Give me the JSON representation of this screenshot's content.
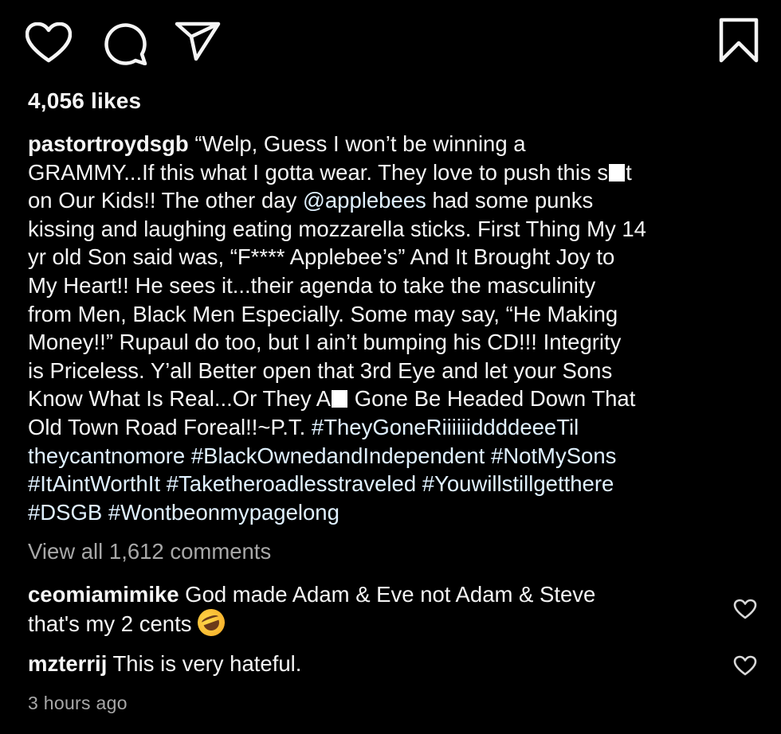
{
  "post": {
    "likes": "4,056 likes",
    "caption": {
      "username": "pastortroydsgb",
      "line1_text": " “Welp, Guess I won’t be winning a",
      "line2_a": "GRAMMY...If this what I gotta wear. They love to push this s",
      "line2_b": "t",
      "line3_a": "on Our Kids!! The other day ",
      "mention": "@applebees",
      "line3_b": " had some punks",
      "line4": "kissing and laughing eating mozzarella sticks. First Thing My 14",
      "line5": "yr old Son said was, “F**** Applebee’s” And It Brought Joy to",
      "line6": "My Heart!! He sees it...their agenda to take the masculinity",
      "line7": "from Men, Black Men Especially. Some may say, “He Making",
      "line8": "Money!!” Rupaul do too, but I ain’t bumping his CD!!! Integrity",
      "line9": "is Priceless. Y’all Better open that 3rd Eye and let your Sons",
      "line10_a": "Know What Is Real...Or They A",
      "line10_b": " Gone Be Headed Down That",
      "line11_a": "Old Town Road Foreal!!~P.T. ",
      "hashtag1_a": "#TheyGoneRiiiiiiddddeeeTil",
      "hashtag1_b": "theycantnomore",
      "hashtag2": "#BlackOwnedandIndependent",
      "hashtag3": "#NotMySons",
      "hashtag4": "#ItAintWorthIt",
      "hashtag5": "#Taketheroadlesstraveled",
      "hashtag6": "#Youwillstillgetthere",
      "hashtag7": "#DSGB",
      "hashtag8": "#Wontbeonmypagelong"
    },
    "view_all_comments": "View all 1,612 comments",
    "comments": [
      {
        "username": "ceomiamimike",
        "text_line1": " God made Adam & Eve not Adam & Steve",
        "text_line2": "that's my 2 cents "
      },
      {
        "username": "mzterrij",
        "text_line1": " This is very hateful."
      }
    ],
    "timestamp": "3 hours ago"
  },
  "icons": {
    "like": "heart-icon",
    "comment": "comment-bubble-icon",
    "share": "paper-plane-icon",
    "save": "bookmark-icon",
    "comment_like": "heart-outline-icon",
    "emoji": "rolling-on-floor-laughing-emoji"
  },
  "colors": {
    "background": "#000000",
    "text": "#f5f5f5",
    "secondary_text": "#a8a8a8",
    "link": "#e0f1ff"
  }
}
